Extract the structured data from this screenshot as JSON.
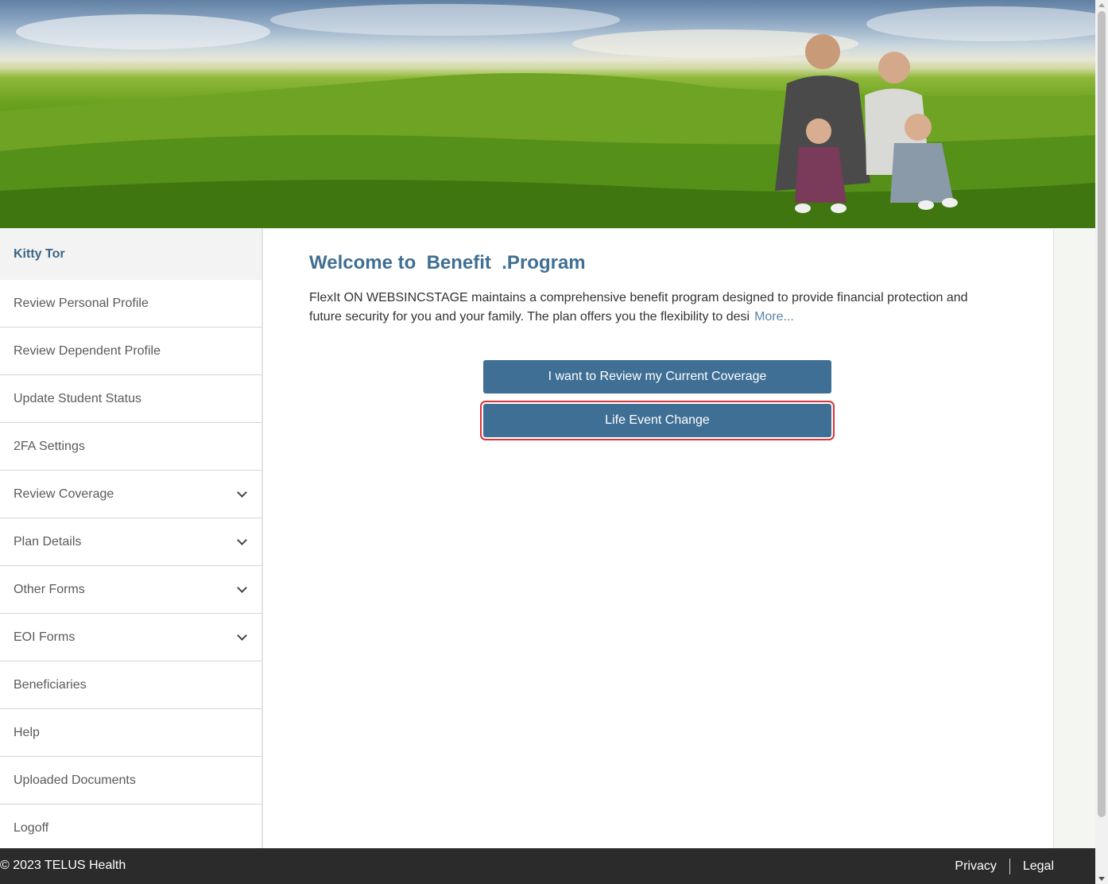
{
  "sidebar": {
    "user_name": "Kitty Tor",
    "items": [
      {
        "label": "Review Personal Profile",
        "expandable": false
      },
      {
        "label": "Review Dependent Profile",
        "expandable": false
      },
      {
        "label": "Update Student Status",
        "expandable": false
      },
      {
        "label": "2FA Settings",
        "expandable": false
      },
      {
        "label": "Review Coverage",
        "expandable": true
      },
      {
        "label": "Plan Details",
        "expandable": true
      },
      {
        "label": "Other Forms",
        "expandable": true
      },
      {
        "label": "EOI Forms",
        "expandable": true
      },
      {
        "label": "Beneficiaries",
        "expandable": false
      },
      {
        "label": "Help",
        "expandable": false
      },
      {
        "label": "Uploaded Documents",
        "expandable": false
      },
      {
        "label": "Logoff",
        "expandable": false
      }
    ]
  },
  "main": {
    "title": "Welcome to  Benefit  .Program",
    "intro": "FlexIt ON WEBSINCSTAGE maintains a comprehensive benefit program designed to provide financial protection and future security for you and your family.  The plan offers you the flexibility to desi",
    "more_link": "More...",
    "review_button": "I want to Review my Current Coverage",
    "life_event_button": "Life Event Change"
  },
  "footer": {
    "copyright": "© 2023 TELUS Health",
    "privacy": "Privacy",
    "legal": "Legal"
  },
  "colors": {
    "accent": "#3f6f94",
    "title": "#3f6f93",
    "highlight": "#d9343a",
    "footer_bg": "#2b2b2b"
  }
}
